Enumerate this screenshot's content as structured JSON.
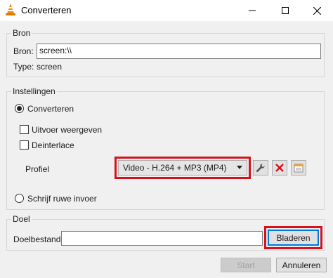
{
  "window": {
    "title": "Converteren",
    "icon": "vlc-cone-icon",
    "controls": [
      "minimize-icon",
      "maximize-icon",
      "close-icon"
    ]
  },
  "source": {
    "legend": "Bron",
    "source_label": "Bron:",
    "source_value": "screen:\\\\",
    "type_label": "Type:",
    "type_value": "screen"
  },
  "settings": {
    "legend": "Instellingen",
    "convert_label": "Converteren",
    "convert_selected": true,
    "show_output_label": "Uitvoer weergeven",
    "show_output_checked": false,
    "deinterlace_label": "Deinterlace",
    "deinterlace_checked": false,
    "profile_label": "Profiel",
    "profile_selected": "Video - H.264 + MP3 (MP4)",
    "profile_tools": [
      "wrench-icon",
      "delete-icon",
      "new-profile-icon"
    ],
    "raw_dump_label": "Schrijf ruwe invoer",
    "raw_dump_selected": false
  },
  "destination": {
    "legend": "Doel",
    "file_label": "Doelbestand:",
    "file_value": "",
    "browse_label": "Bladeren"
  },
  "footer": {
    "start_label": "Start",
    "start_enabled": false,
    "cancel_label": "Annuleren"
  },
  "colors": {
    "highlight": "#d9111d",
    "delete_icon": "#d9111d",
    "primary_border": "#0078d7"
  }
}
